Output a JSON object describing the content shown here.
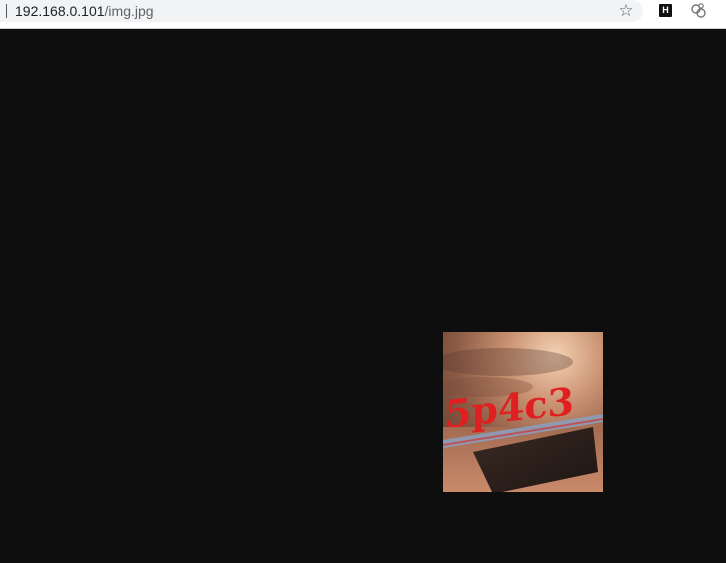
{
  "browser": {
    "url_host": "192.168.0.101",
    "url_path": "/img.jpg",
    "extensions": [
      {
        "name": "H",
        "icon": "h-extension-icon"
      },
      {
        "name": "",
        "icon": "link-extension-icon"
      }
    ],
    "bookmark_icon": "star-icon"
  },
  "image": {
    "caption_text": "5p4c3",
    "colors": {
      "background": "#0e0e0e",
      "text_red": "#e02020"
    }
  }
}
